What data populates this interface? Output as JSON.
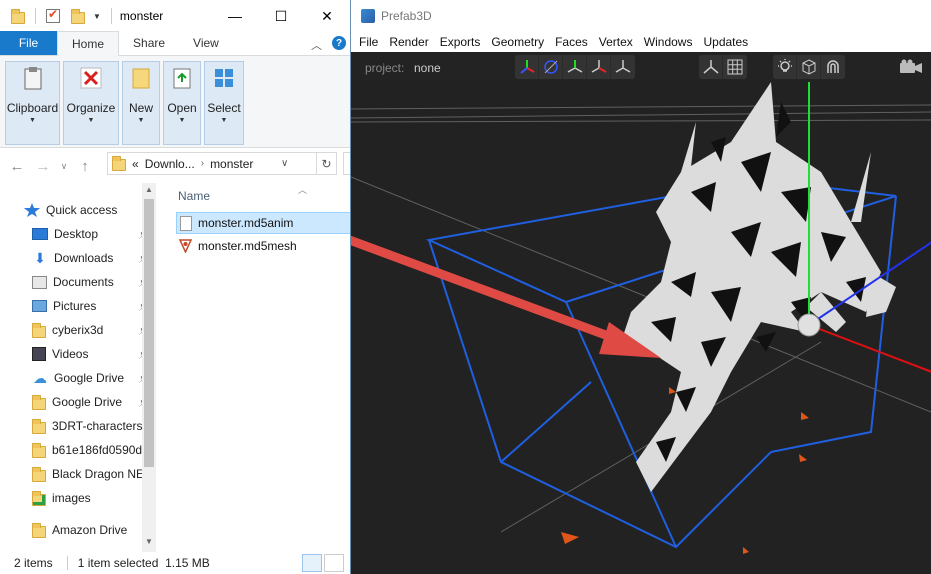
{
  "explorer": {
    "title": "monster",
    "window_controls": {
      "minimize": "—",
      "maximize": "☐",
      "close": "✕"
    },
    "tabs": {
      "file": "File",
      "home": "Home",
      "share": "Share",
      "view": "View"
    },
    "ribbon": [
      {
        "label": "Clipboard",
        "icon": "clipboard-icon"
      },
      {
        "label": "Organize",
        "icon": "organize-icon"
      },
      {
        "label": "New",
        "icon": "new-folder-icon"
      },
      {
        "label": "Open",
        "icon": "open-icon"
      },
      {
        "label": "Select",
        "icon": "select-icon"
      }
    ],
    "address": {
      "prefix": "«",
      "segment1": "Downlo...",
      "segment2": "monster"
    },
    "nav": {
      "quick_access": "Quick access",
      "items": [
        {
          "label": "Desktop",
          "icon": "desktop-icon",
          "pinned": true
        },
        {
          "label": "Downloads",
          "icon": "downloads-icon",
          "pinned": true
        },
        {
          "label": "Documents",
          "icon": "documents-icon",
          "pinned": true
        },
        {
          "label": "Pictures",
          "icon": "pictures-icon",
          "pinned": true
        },
        {
          "label": "cyberix3d",
          "icon": "folder-icon",
          "pinned": true
        },
        {
          "label": "Videos",
          "icon": "videos-icon",
          "pinned": true
        },
        {
          "label": "Google Drive",
          "icon": "cloud-icon",
          "pinned": true
        },
        {
          "label": "Google Drive",
          "icon": "folder-icon",
          "pinned": true
        },
        {
          "label": "3DRT-characters",
          "icon": "folder-icon",
          "pinned": false
        },
        {
          "label": "b61e186fd0590d",
          "icon": "folder-icon",
          "pinned": false
        },
        {
          "label": "Black Dragon NE",
          "icon": "folder-icon",
          "pinned": false
        },
        {
          "label": "images",
          "icon": "folder-synced-icon",
          "pinned": false
        },
        {
          "label": "Amazon Drive",
          "icon": "folder-icon",
          "pinned": false
        }
      ]
    },
    "files": {
      "column_name": "Name",
      "rows": [
        {
          "name": "monster.md5anim",
          "selected": true
        },
        {
          "name": "monster.md5mesh",
          "selected": false
        }
      ]
    },
    "status": {
      "count": "2 items",
      "selection": "1 item selected  1.15 MB"
    }
  },
  "prefab": {
    "title": "Prefab3D",
    "menu": [
      "File",
      "Render",
      "Exports",
      "Geometry",
      "Faces",
      "Vertex",
      "Windows",
      "Updates"
    ],
    "project_label": "project:",
    "project_value": "none",
    "colors": {
      "bbox": "#1f5fe0",
      "arrow": "#e04a44",
      "y_axis": "#22dd33",
      "x_axis": "#dd1111",
      "z_axis": "#2233ee"
    }
  }
}
